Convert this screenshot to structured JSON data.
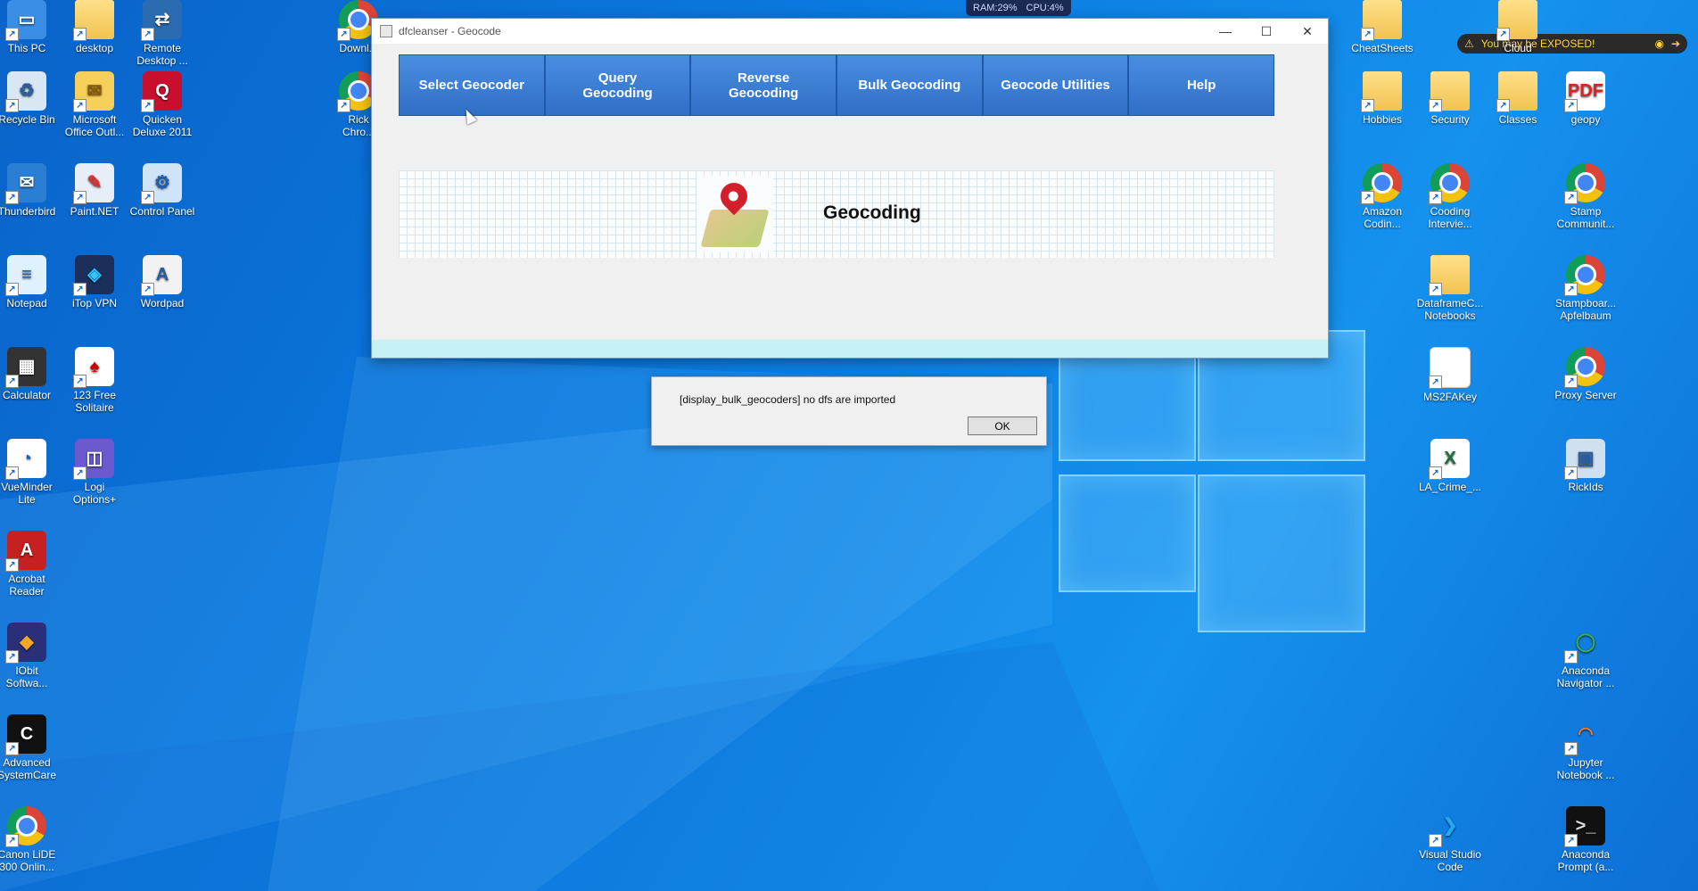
{
  "system": {
    "ram": "RAM:29%",
    "cpu": "CPU:4%",
    "exposed_text": "You may be EXPOSED!"
  },
  "window": {
    "title": "dfcleanser - Geocode",
    "nav": [
      "Select Geocoder",
      "Query\nGeocoding",
      "Reverse\nGeocoding",
      "Bulk Geocoding",
      "Geocode Utilities",
      "Help"
    ],
    "banner_heading": "Geocoding"
  },
  "dialog": {
    "message": "[display_bulk_geocoders] no dfs are imported",
    "ok_label": "OK"
  },
  "desktop_left": [
    {
      "label": "This PC",
      "icon": "computer-icon"
    },
    {
      "label": "desktop",
      "icon": "folder-icon"
    },
    {
      "label": "Remote\nDesktop ...",
      "icon": "remote-desktop-icon"
    },
    {
      "label": "Downl...",
      "icon": "chrome-icon"
    },
    {
      "label": "Recycle Bin",
      "icon": "recycle-bin-icon"
    },
    {
      "label": "Microsoft\nOffice Outl...",
      "icon": "outlook-icon"
    },
    {
      "label": "Quicken\nDeluxe 2011",
      "icon": "quicken-icon"
    },
    {
      "label": "Rick\nChro...",
      "icon": "chrome-icon"
    },
    {
      "label": "Thunderbird",
      "icon": "thunderbird-icon"
    },
    {
      "label": "Paint.NET",
      "icon": "paintnet-icon"
    },
    {
      "label": "Control Panel",
      "icon": "control-panel-icon"
    },
    {
      "label": "Notepad",
      "icon": "notepad-icon"
    },
    {
      "label": "iTop VPN",
      "icon": "vpn-icon"
    },
    {
      "label": "Wordpad",
      "icon": "wordpad-icon"
    },
    {
      "label": "Calculator",
      "icon": "calculator-icon"
    },
    {
      "label": "123 Free\nSolitaire",
      "icon": "cards-icon"
    },
    {
      "label": "VueMinder\nLite",
      "icon": "vueminder-icon"
    },
    {
      "label": "Logi\nOptions+",
      "icon": "logi-icon"
    },
    {
      "label": "Acrobat\nReader",
      "icon": "acrobat-icon"
    },
    {
      "label": "IObit\nSoftwa...",
      "icon": "iobit-icon"
    },
    {
      "label": "Advanced\nSystemCare",
      "icon": "systemcare-icon"
    },
    {
      "label": "Canon LiDE\n300 Onlin...",
      "icon": "chrome-icon"
    }
  ],
  "desktop_right": [
    {
      "label": "CheatSheets",
      "icon": "folder-icon"
    },
    {
      "label": "Cloud",
      "icon": "folder-icon"
    },
    {
      "label": "Hobbies",
      "icon": "folder-icon"
    },
    {
      "label": "Security",
      "icon": "folder-icon"
    },
    {
      "label": "Classes",
      "icon": "folder-icon"
    },
    {
      "label": "geopy",
      "icon": "pdf-icon"
    },
    {
      "label": "Amazon\nCodin...",
      "icon": "chrome-icon"
    },
    {
      "label": "Cooding\nIntervie...",
      "icon": "chrome-icon"
    },
    {
      "label": "Stamp\nCommunit...",
      "icon": "chrome-icon"
    },
    {
      "label": "DataframeC...\nNotebooks",
      "icon": "folder-icon"
    },
    {
      "label": "Stampboar...\nApfelbaum",
      "icon": "chrome-icon"
    },
    {
      "label": "MS2FAKey",
      "icon": "document-icon"
    },
    {
      "label": "Proxy Server",
      "icon": "chrome-icon"
    },
    {
      "label": "LA_Crime_...",
      "icon": "excel-icon"
    },
    {
      "label": "RickIds",
      "icon": "image-icon"
    },
    {
      "label": "Anaconda\nNavigator ...",
      "icon": "anaconda-icon"
    },
    {
      "label": "Jupyter\nNotebook ...",
      "icon": "jupyter-icon"
    },
    {
      "label": "Visual Studio\nCode",
      "icon": "vscode-icon"
    },
    {
      "label": "Anaconda\nPrompt (a...",
      "icon": "terminal-icon"
    }
  ]
}
